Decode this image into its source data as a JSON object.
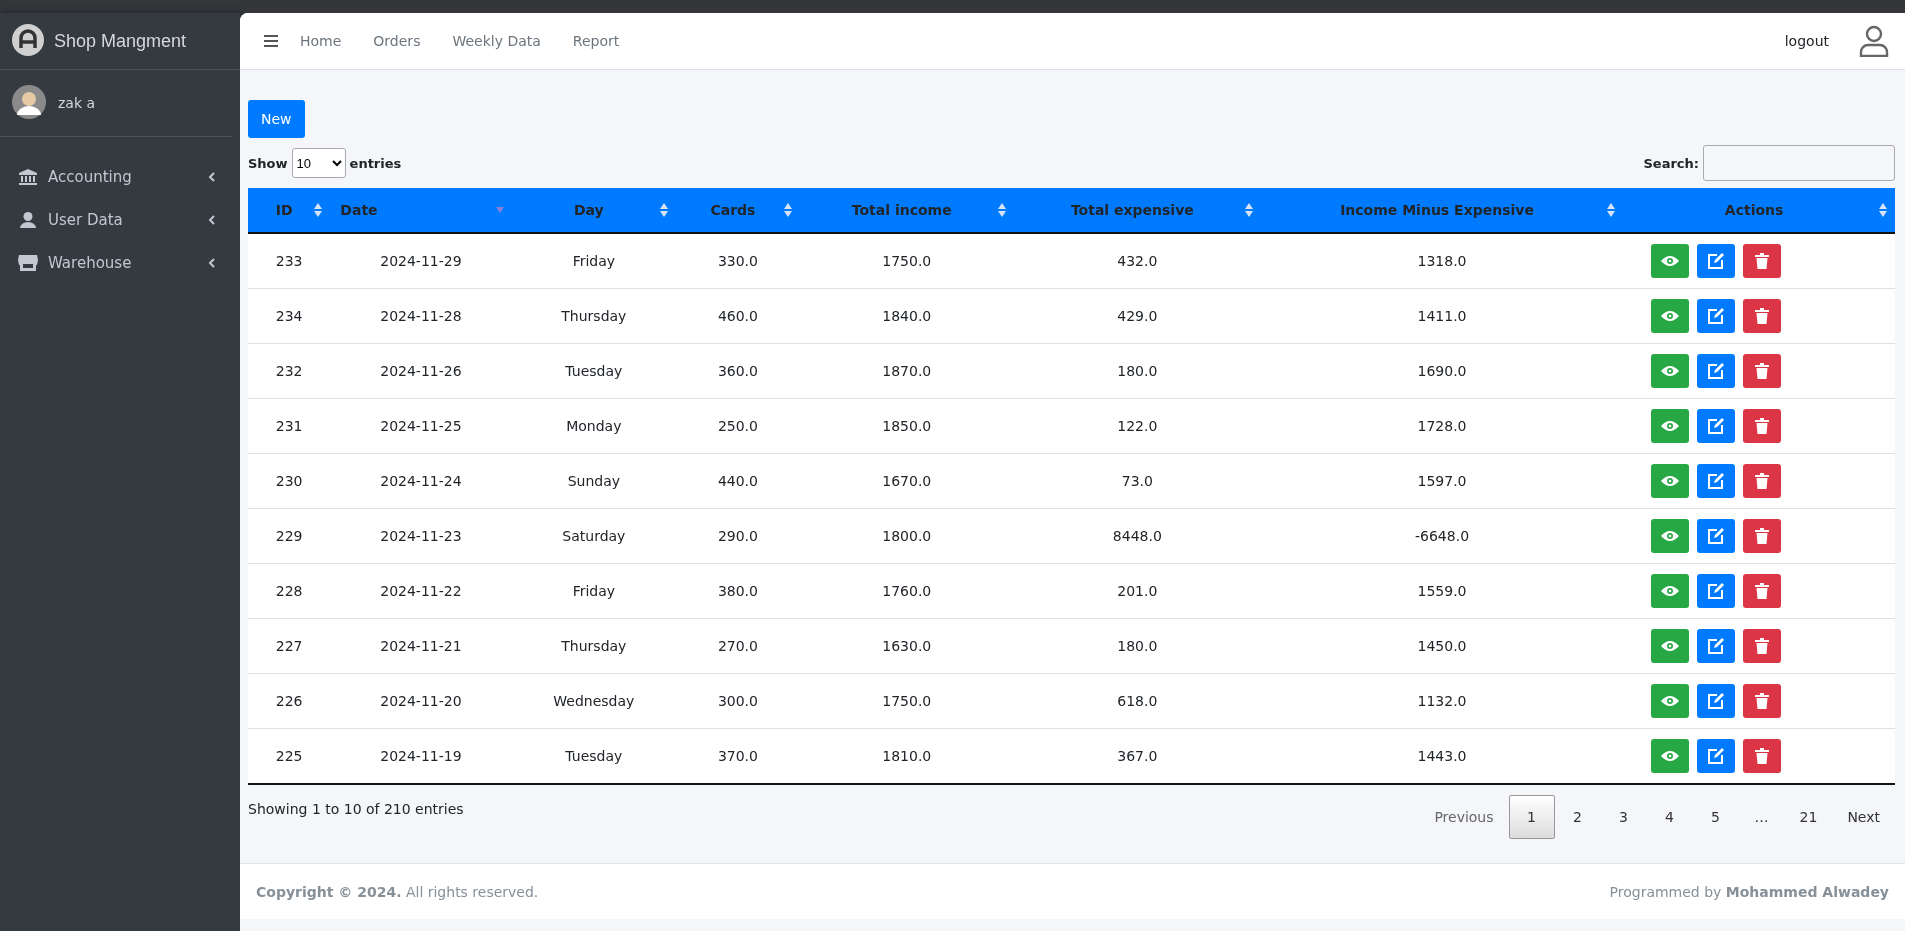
{
  "sidebar": {
    "brand": "Shop Mangment",
    "user": "zak a",
    "items": [
      {
        "label": "Accounting",
        "expanded": false
      },
      {
        "label": "User Data",
        "expanded": false
      },
      {
        "label": "Warehouse",
        "expanded": false
      }
    ]
  },
  "navbar": {
    "links": [
      "Home",
      "Orders",
      "Weekly Data",
      "Report"
    ],
    "logout": "logout"
  },
  "toolbar": {
    "new_button": "New",
    "show_label": "Show",
    "page_size": "10",
    "entries_label": "entries",
    "search_label": "Search:"
  },
  "table": {
    "columns": [
      {
        "label": "ID",
        "sorted": false
      },
      {
        "label": "Date",
        "sorted": true
      },
      {
        "label": "Day",
        "sorted": false
      },
      {
        "label": "Cards",
        "sorted": false
      },
      {
        "label": "Total income",
        "sorted": false
      },
      {
        "label": "Total expensive",
        "sorted": false
      },
      {
        "label": "Income Minus Expensive",
        "sorted": false
      },
      {
        "label": "Actions",
        "sorted": false
      }
    ],
    "rows": [
      [
        "233",
        "2024-11-29",
        "Friday",
        "330.0",
        "1750.0",
        "432.0",
        "1318.0"
      ],
      [
        "234",
        "2024-11-28",
        "Thursday",
        "460.0",
        "1840.0",
        "429.0",
        "1411.0"
      ],
      [
        "232",
        "2024-11-26",
        "Tuesday",
        "360.0",
        "1870.0",
        "180.0",
        "1690.0"
      ],
      [
        "231",
        "2024-11-25",
        "Monday",
        "250.0",
        "1850.0",
        "122.0",
        "1728.0"
      ],
      [
        "230",
        "2024-11-24",
        "Sunday",
        "440.0",
        "1670.0",
        "73.0",
        "1597.0"
      ],
      [
        "229",
        "2024-11-23",
        "Saturday",
        "290.0",
        "1800.0",
        "8448.0",
        "-6648.0"
      ],
      [
        "228",
        "2024-11-22",
        "Friday",
        "380.0",
        "1760.0",
        "201.0",
        "1559.0"
      ],
      [
        "227",
        "2024-11-21",
        "Thursday",
        "270.0",
        "1630.0",
        "180.0",
        "1450.0"
      ],
      [
        "226",
        "2024-11-20",
        "Wednesday",
        "300.0",
        "1750.0",
        "618.0",
        "1132.0"
      ],
      [
        "225",
        "2024-11-19",
        "Tuesday",
        "370.0",
        "1810.0",
        "367.0",
        "1443.0"
      ]
    ]
  },
  "info": "Showing 1 to 10 of 210 entries",
  "pagination": {
    "previous": "Previous",
    "next": "Next",
    "pages": [
      {
        "label": "1",
        "selected": true
      },
      {
        "label": "2",
        "selected": false
      },
      {
        "label": "3",
        "selected": false
      },
      {
        "label": "4",
        "selected": false
      },
      {
        "label": "5",
        "selected": false
      },
      {
        "label": "…",
        "selected": false
      },
      {
        "label": "21",
        "selected": false
      }
    ]
  },
  "footer": {
    "copyright": "**Copyright © 2024.** All rights reserved.",
    "credit": "Programmed by **Mohammed Alwadey**"
  }
}
